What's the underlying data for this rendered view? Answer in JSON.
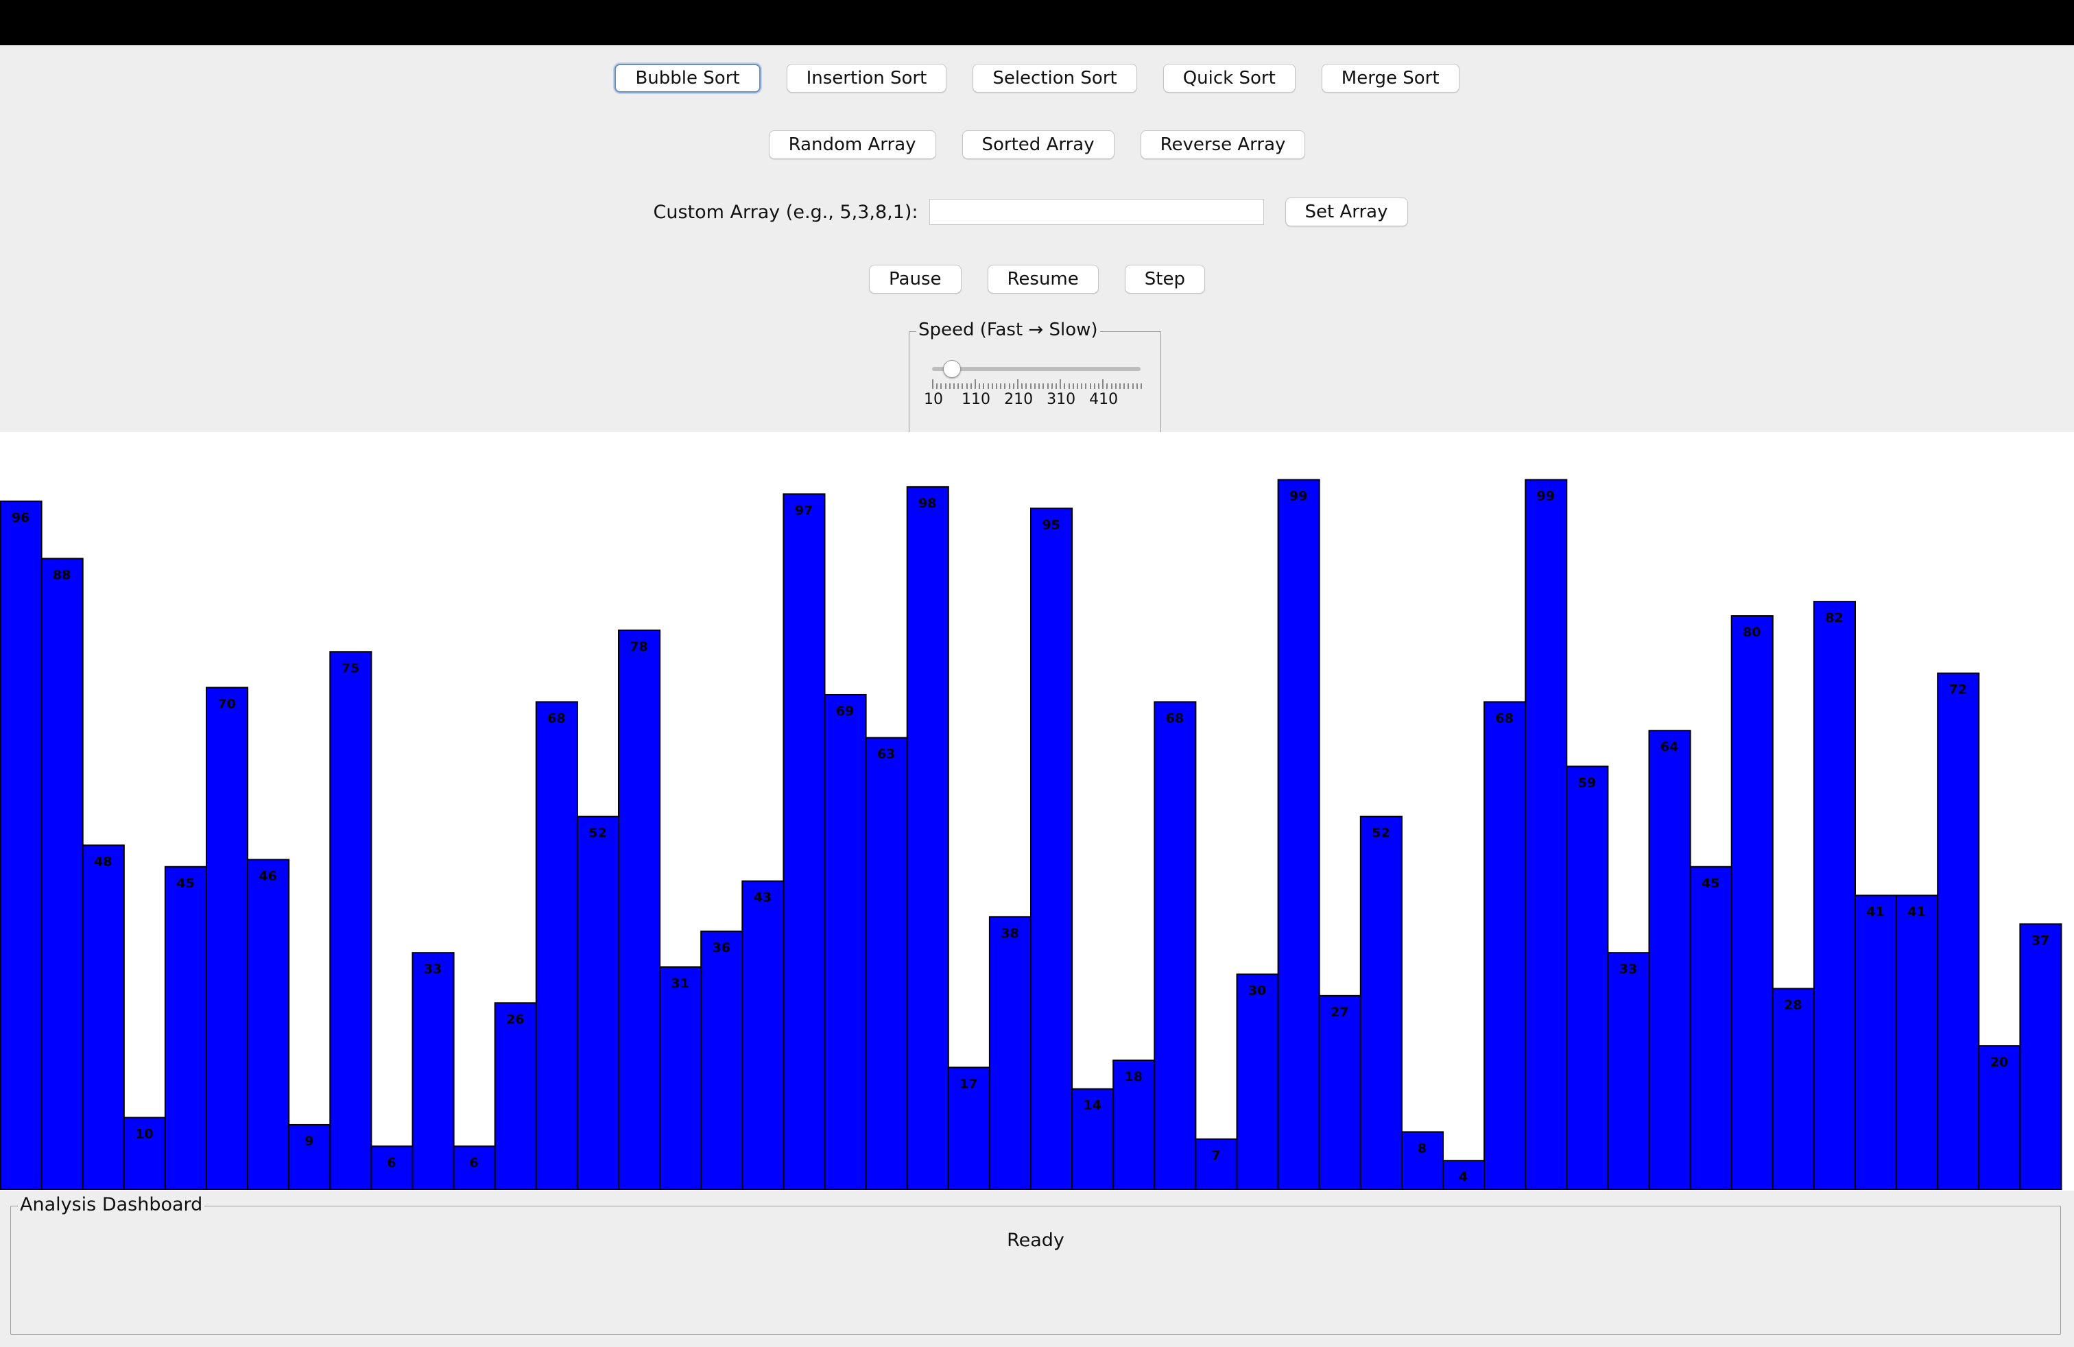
{
  "controls": {
    "algorithms": [
      "Bubble Sort",
      "Insertion Sort",
      "Selection Sort",
      "Quick Sort",
      "Merge Sort"
    ],
    "array_presets": [
      "Random Array",
      "Sorted Array",
      "Reverse Array"
    ],
    "custom_array": {
      "label": "Custom Array (e.g., 5,3,8,1):",
      "value": "",
      "placeholder": "",
      "button": "Set Array"
    },
    "playback": [
      "Pause",
      "Resume",
      "Step"
    ],
    "speed": {
      "title": "Speed (Fast → Slow)",
      "min": 10,
      "max": 500,
      "value": 55,
      "tick_labels": [
        "10",
        "110",
        "210",
        "310",
        "410"
      ]
    }
  },
  "chart_data": {
    "type": "bar",
    "values": [
      96,
      88,
      48,
      10,
      45,
      70,
      46,
      9,
      75,
      6,
      33,
      6,
      26,
      68,
      52,
      78,
      31,
      36,
      43,
      97,
      69,
      63,
      98,
      17,
      38,
      95,
      14,
      18,
      68,
      7,
      30,
      99,
      27,
      52,
      8,
      4,
      68,
      99,
      59,
      33,
      64,
      45,
      80,
      28,
      82,
      41,
      41,
      72,
      20,
      37
    ],
    "ylim": [
      0,
      100
    ],
    "bar_color": "#0000ff"
  },
  "dashboard": {
    "title": "Analysis Dashboard",
    "status": "Ready"
  },
  "colors": {
    "titlebar": "#000000",
    "panel": "#eeeeee",
    "chart_bg": "#ffffff",
    "bar_fill": "#0000ff",
    "bar_stroke": "#000000"
  }
}
